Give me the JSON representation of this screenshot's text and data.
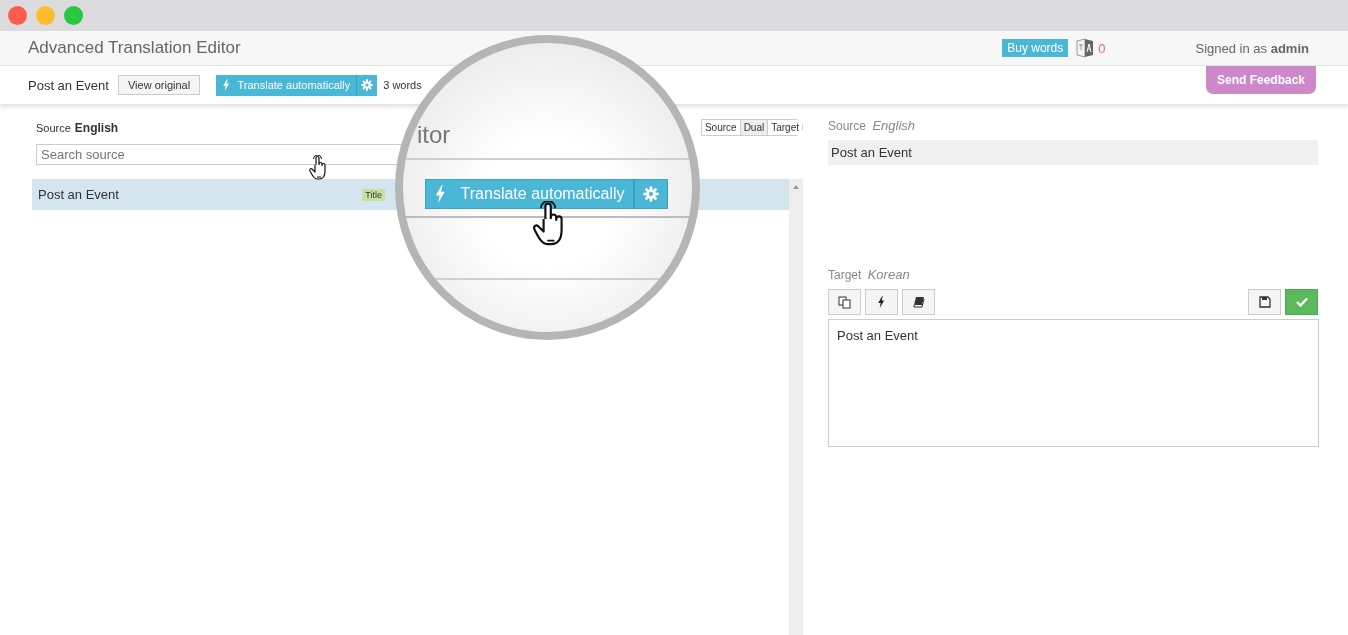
{
  "header": {
    "title": "Advanced Translation Editor",
    "buy_button": "Buy words",
    "credits": "0",
    "signed_in": "Signed in as **admin**"
  },
  "toolbar": {
    "document_title": "Post an Event",
    "view_original": "View original",
    "translate_button": "Translate automatically",
    "word_count": "3 words",
    "feedback_button": "Send Feedback"
  },
  "left_panel": {
    "source_label": "Source",
    "source_language": "English",
    "search": {
      "placeholder": "Search source"
    },
    "view_modes": [
      {
        "label": "Source",
        "selected": false
      },
      {
        "label": "Dual",
        "selected": true
      },
      {
        "label": "Target",
        "selected": false
      }
    ],
    "rows": [
      {
        "text": "Post an Event",
        "tag": "Title",
        "selected": true
      }
    ]
  },
  "right_panel": {
    "source_label": "Source",
    "source_language": "English",
    "source_text": "Post an Event",
    "target_label": "Target",
    "target_language": "Korean",
    "target_text": "Post an Event"
  },
  "magnifier": {
    "title_fragment": "itor",
    "translate_button": "Translate automatically"
  }
}
